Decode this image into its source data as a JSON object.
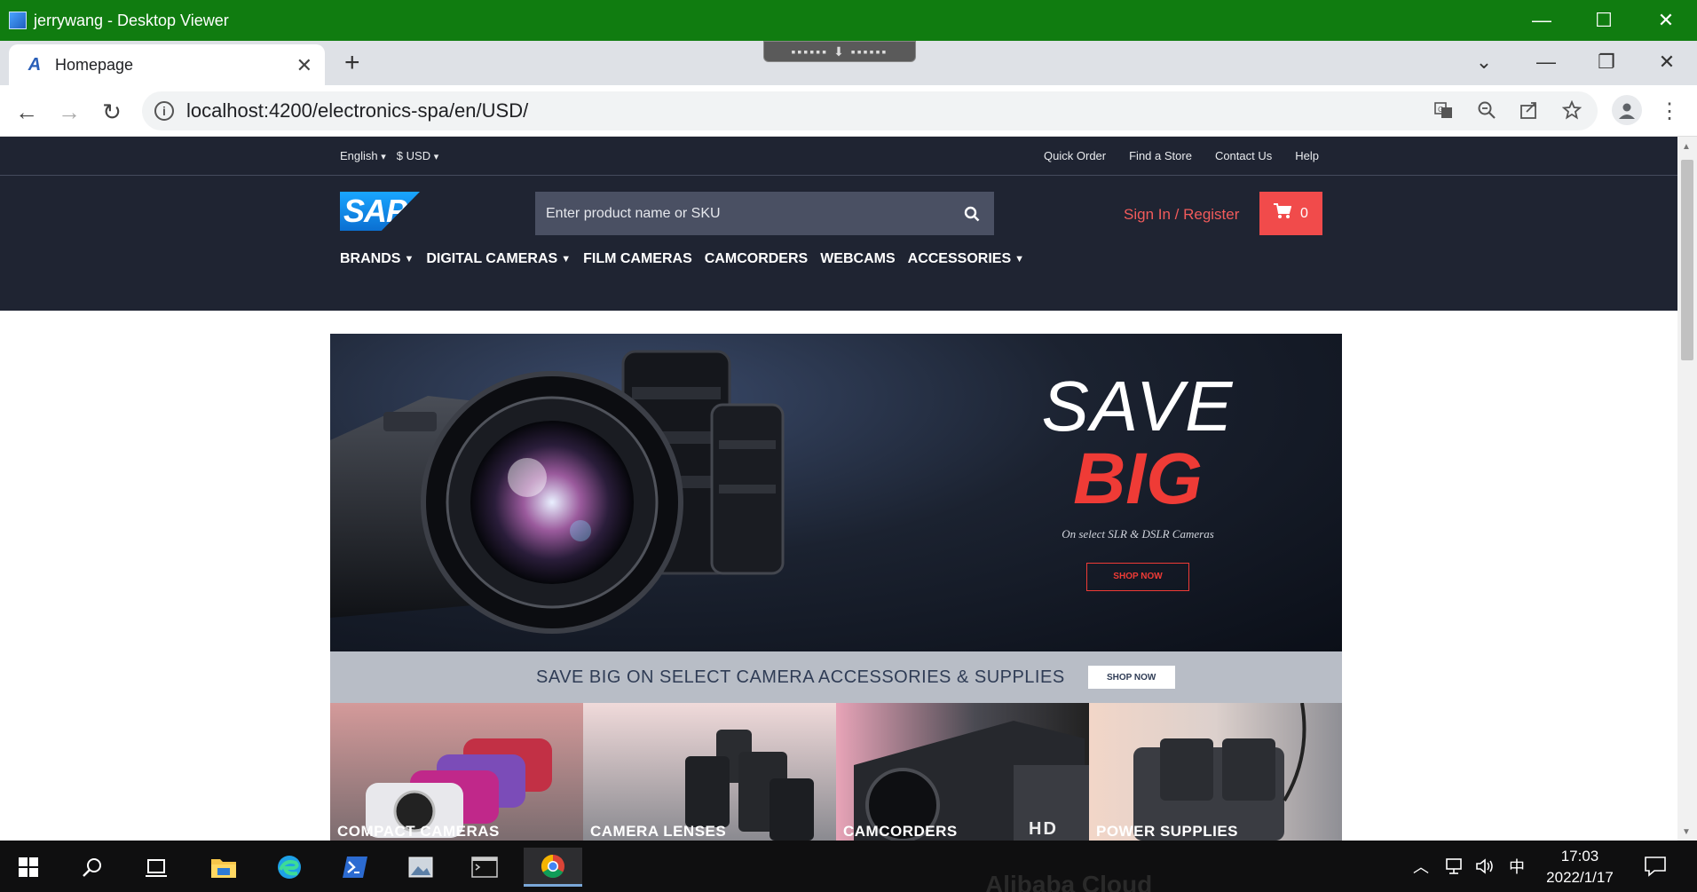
{
  "window": {
    "title": "jerrywang - Desktop Viewer",
    "controls": [
      "—",
      "☐",
      "✕"
    ]
  },
  "browser": {
    "tab": {
      "title": "Homepage",
      "favicon": "A",
      "close": "✕"
    },
    "new_tab": "+",
    "url": "localhost:4200/electronics-spa/en/USD/",
    "nav": {
      "back": "←",
      "forward": "→",
      "reload": "↻"
    },
    "tabstrip_icons": [
      "⌄",
      "—",
      "❐",
      "✕"
    ],
    "omni_icons": [
      "translate-icon",
      "zoom-icon",
      "share-icon",
      "star-icon"
    ]
  },
  "site": {
    "language": "English",
    "currency": "$ USD",
    "top_links": [
      "Quick Order",
      "Find a Store",
      "Contact Us",
      "Help"
    ],
    "logo_text": "SAP",
    "search_placeholder": "Enter product name or SKU",
    "sign_in": "Sign In / Register",
    "cart_count": "0",
    "nav": [
      {
        "label": "BRANDS",
        "dropdown": true
      },
      {
        "label": "DIGITAL CAMERAS",
        "dropdown": true
      },
      {
        "label": "FILM CAMERAS",
        "dropdown": false
      },
      {
        "label": "CAMCORDERS",
        "dropdown": false
      },
      {
        "label": "WEBCAMS",
        "dropdown": false
      },
      {
        "label": "ACCESSORIES",
        "dropdown": true
      }
    ],
    "hero": {
      "line1": "SAVE",
      "line2": "BIG",
      "subtitle": "On select SLR & DSLR Cameras",
      "button": "SHOP NOW"
    },
    "promo": {
      "text": "SAVE BIG ON SELECT CAMERA ACCESSORIES & SUPPLIES",
      "button": "SHOP NOW"
    },
    "tiles": [
      "COMPACT CAMERAS",
      "CAMERA LENSES",
      "CAMCORDERS",
      "POWER SUPPLIES"
    ],
    "hd_mark": "HD"
  },
  "taskbar": {
    "time": "17:03",
    "date": "2022/1/17",
    "ime": "中",
    "background_text": "Alibaba Cloud"
  }
}
